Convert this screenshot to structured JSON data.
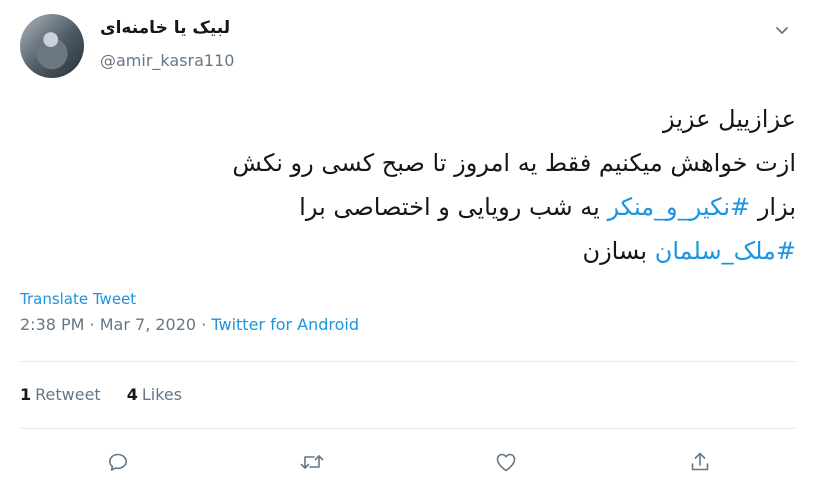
{
  "author": {
    "display_name": "لبیک یا خامنه‌ای",
    "handle": "@amir_kasra110"
  },
  "tweet": {
    "line1": "عزازییل عزیز",
    "line2": "ازت خواهش میکنیم فقط یه امروز تا صبح کسی رو نکش",
    "line3_pre": "بزار",
    "line3_tag": "#نکیر_و_منکر",
    "line3_post": "یه شب رویایی و اختصاصی برا",
    "line4_tag": "#ملک_سلمان",
    "line4_post": "بسازن"
  },
  "translate_label": "Translate Tweet",
  "meta": {
    "time": "2:38 PM",
    "separator": "·",
    "date": "Mar 7, 2020",
    "source": "Twitter for Android"
  },
  "stats": {
    "retweets_count": "1",
    "retweets_label": "Retweet",
    "likes_count": "4",
    "likes_label": "Likes"
  },
  "icons": {
    "caret": "chevron-down-icon",
    "reply": "reply-icon",
    "retweet": "retweet-icon",
    "like": "heart-icon",
    "share": "share-icon"
  },
  "colors": {
    "link": "#1b95e0",
    "secondary": "#657786",
    "text": "#14171a",
    "divider": "#e6ecf0"
  }
}
